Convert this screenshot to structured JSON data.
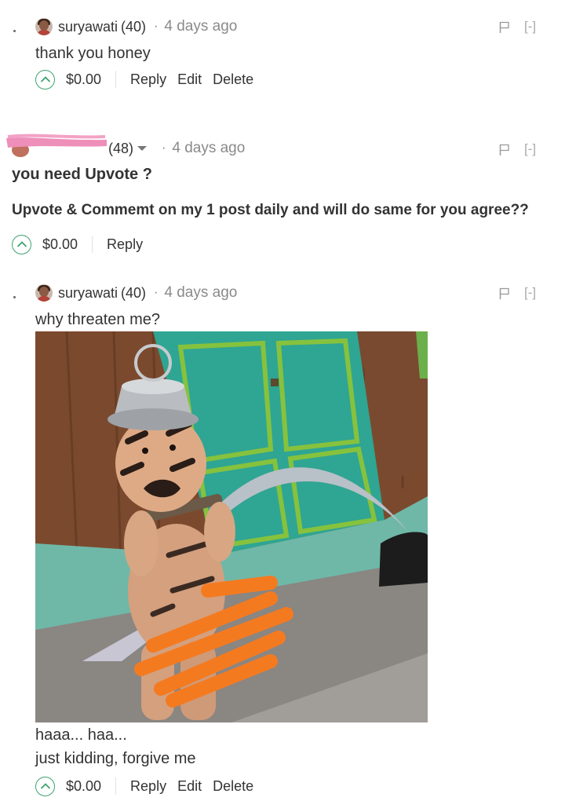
{
  "comments": [
    {
      "author": "suryawati",
      "reputation": "(40)",
      "separator": "·",
      "time_ago": "4 days ago",
      "lines": [
        "thank you honey"
      ],
      "payout": "$0.00",
      "actions": [
        "Reply",
        "Edit",
        "Delete"
      ],
      "collapse": "[-]"
    },
    {
      "author": "",
      "reputation": "(48)",
      "separator": "·",
      "time_ago": "4 days ago",
      "lines": [
        "you need Upvote ?",
        "Upvote & Commemt on my 1 post daily and will do same for you agree??"
      ],
      "payout": "$0.00",
      "actions": [
        "Reply"
      ],
      "collapse": "[-]"
    },
    {
      "author": "suryawati",
      "reputation": "(40)",
      "separator": "·",
      "time_ago": "4 days ago",
      "lines": [
        "why threaten me?",
        "haaa... haa...",
        "just kidding, forgive me"
      ],
      "payout": "$0.00",
      "actions": [
        "Reply",
        "Edit",
        "Delete"
      ],
      "collapse": "[-]"
    }
  ],
  "icons": {
    "upvote": "chevron-up-circle-icon",
    "flag": "flag-icon",
    "dropdown": "caret-down-icon"
  },
  "colors": {
    "upvote_green": "#3ea26f",
    "text": "#333333",
    "muted": "#8a8a8a",
    "redaction_pink": "#ee8fb9",
    "redaction_orange": "#f47a20"
  }
}
